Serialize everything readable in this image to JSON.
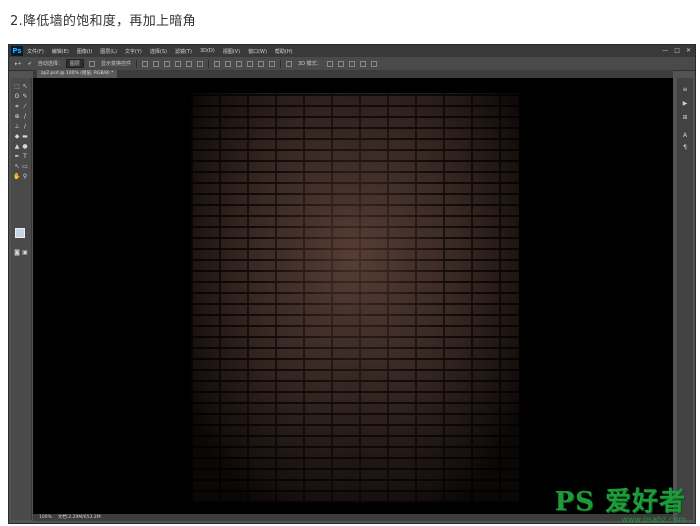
{
  "caption": "2.降低墙的饱和度，再加上暗角",
  "app": {
    "logo": "Ps",
    "menu": [
      "文件(F)",
      "编辑(E)",
      "图像(I)",
      "图层(L)",
      "文字(Y)",
      "选择(S)",
      "滤镜(T)",
      "3D(D)",
      "视图(V)",
      "窗口(W)",
      "帮助(H)"
    ],
    "window_buttons": [
      "—",
      "□",
      "✕"
    ]
  },
  "options": {
    "auto_select_label": "自动选择：",
    "auto_select_value": "图层",
    "transform_label": "显示变换控件",
    "mode_3d_label": "3D 模式："
  },
  "document": {
    "tab_title": "zp2.psd @ 100% (组层, RGB/8) *"
  },
  "status": {
    "zoom": "100%",
    "doc_info": "文档:2.29M/653.2M"
  },
  "watermark": {
    "main": "PS 爱好者",
    "url": "www.psahz.com"
  }
}
